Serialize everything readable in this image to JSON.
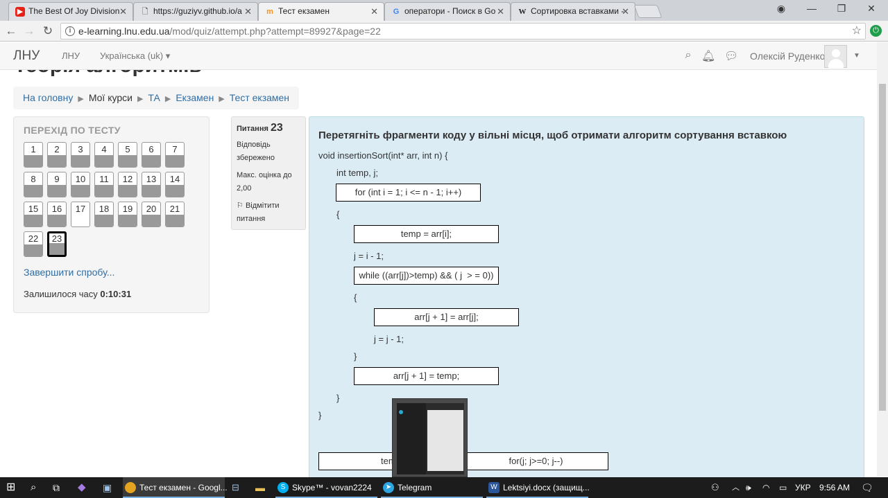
{
  "browser": {
    "tabs": [
      {
        "title": "The Best Of Joy Division -",
        "icon": "youtube-icon"
      },
      {
        "title": "https://guziyv.github.io/a",
        "icon": "document-icon"
      },
      {
        "title": "Тест екзамен",
        "icon": "moodle-icon",
        "active": true
      },
      {
        "title": "оператори - Поиск в Go",
        "icon": "google-icon"
      },
      {
        "title": "Сортировка вставками -",
        "icon": "wikipedia-icon"
      }
    ],
    "url_host": "e-learning.lnu.edu.ua",
    "url_path": "/mod/quiz/attempt.php?attempt=89927&page=22"
  },
  "navbar": {
    "brand": "ЛНУ",
    "link_lnu": "ЛНУ",
    "language": "Українська (uk)",
    "user_name": "Олексій Руденко"
  },
  "page": {
    "heading": "Теорія алгоритмів",
    "breadcrumb": [
      "На головну",
      "Мої курси",
      "ТА",
      "Екзамен",
      "Тест екзамен"
    ]
  },
  "quiz_nav": {
    "title": "ПЕРЕХІД ПО ТЕСТУ",
    "questions": [
      {
        "n": "1",
        "answered": true
      },
      {
        "n": "2",
        "answered": true
      },
      {
        "n": "3",
        "answered": true
      },
      {
        "n": "4",
        "answered": true
      },
      {
        "n": "5",
        "answered": true
      },
      {
        "n": "6",
        "answered": true
      },
      {
        "n": "7",
        "answered": true
      },
      {
        "n": "8",
        "answered": true
      },
      {
        "n": "9",
        "answered": true
      },
      {
        "n": "10",
        "answered": true
      },
      {
        "n": "11",
        "answered": true
      },
      {
        "n": "12",
        "answered": true
      },
      {
        "n": "13",
        "answered": true
      },
      {
        "n": "14",
        "answered": true
      },
      {
        "n": "15",
        "answered": true
      },
      {
        "n": "16",
        "answered": true
      },
      {
        "n": "17",
        "answered": false
      },
      {
        "n": "18",
        "answered": true
      },
      {
        "n": "19",
        "answered": true
      },
      {
        "n": "20",
        "answered": true
      },
      {
        "n": "21",
        "answered": true
      },
      {
        "n": "22",
        "answered": true
      },
      {
        "n": "23",
        "answered": false,
        "current": true
      }
    ],
    "finish_label": "Завершити спробу...",
    "time_label": "Залишилося часу",
    "time_value": "0:10:31"
  },
  "question_info": {
    "label": "Питання",
    "number": "23",
    "status": "Відповідь збережено",
    "max_grade": "Макс. оцінка до 2,00",
    "flag": "Відмітити питання"
  },
  "question": {
    "text": "Перетягніть фрагменти коду у вільні місця, щоб отримати алгоритм сортування вставкою",
    "code_lines": [
      "void insertionSort(int* arr, int n) {",
      "int temp, j;",
      "{",
      "j = i - 1;",
      "{",
      "j = j - 1;",
      "}",
      "}",
      "}"
    ],
    "drops": [
      "for (int i = 1; i <= n - 1; i++)",
      "temp = arr[i];",
      "while ((arr[j])>temp) && ( j  > = 0))",
      "arr[j + 1] = arr[j];",
      "arr[j + 1] = temp;"
    ],
    "choices": [
      "temp",
      "for(j; j>=0; j--)"
    ]
  },
  "taskbar": {
    "apps": [
      {
        "label": "Тест екзамен - Googl...",
        "icon": "chrome-icon"
      },
      {
        "label": "Skype™ - vovan2224",
        "icon": "skype-icon"
      },
      {
        "label": "Telegram",
        "icon": "telegram-icon"
      },
      {
        "label": "Lektsiyi.docx (защищ...",
        "icon": "word-icon"
      }
    ],
    "lang": "УКР",
    "time": "9:56 AM"
  }
}
